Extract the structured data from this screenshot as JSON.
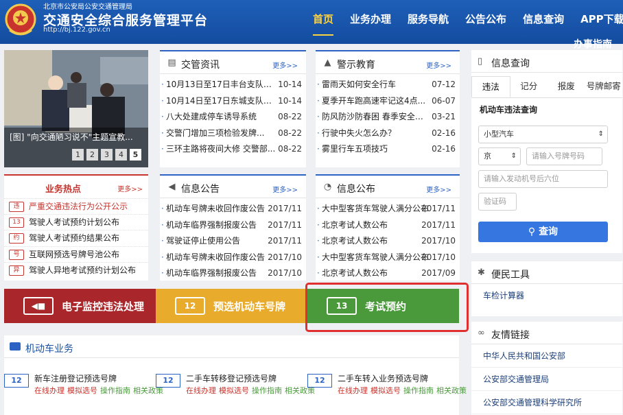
{
  "header": {
    "org": "北京市公安局公安交通管理局",
    "title": "交通安全综合服务管理平台",
    "url": "http://bj.122.gov.cn",
    "nav": [
      "首页",
      "业务办理",
      "服务导航",
      "公告公布",
      "信息查询",
      "APP下载"
    ],
    "nav_overflow": "办事指南"
  },
  "slideshow": {
    "caption": "[图] \"向交通陋习说不\"主题宣教...",
    "pages": [
      "1",
      "2",
      "3",
      "4",
      "5"
    ],
    "active_page": "5"
  },
  "news": {
    "title": "交管资讯",
    "more": "更多>>",
    "items": [
      {
        "text": "10月13日至17日丰台支队方...",
        "date": "10-14"
      },
      {
        "text": "10月14日至17日东城支队广...",
        "date": "10-14"
      },
      {
        "text": "八大处建成停车诱导系统",
        "date": "08-22"
      },
      {
        "text": "交警门增加三项检验发牌...",
        "date": "08-22"
      },
      {
        "text": "三环主路将夜间大修 交警部...",
        "date": "08-22"
      }
    ]
  },
  "warning": {
    "title": "警示教育",
    "more": "更多>>",
    "items": [
      {
        "text": "雷雨天如何安全行车",
        "date": "07-12"
      },
      {
        "text": "夏季开车跑高速牢记这4点...",
        "date": "06-07"
      },
      {
        "text": "防风防沙防春困 春季安全行...",
        "date": "03-21"
      },
      {
        "text": "行驶中失火怎么办？",
        "date": "02-16"
      },
      {
        "text": "雾里行车五项技巧",
        "date": "02-16"
      }
    ]
  },
  "hot": {
    "title": "业务热点",
    "more": "更多>>",
    "items": [
      {
        "icon": "违",
        "text": "严重交通违法行为公开公示"
      },
      {
        "icon": "13",
        "text": "驾驶人考试预约计划公布"
      },
      {
        "icon": "约",
        "text": "驾驶人考试预约结果公布"
      },
      {
        "icon": "号",
        "text": "互联网预选号牌号池公布"
      },
      {
        "icon": "异",
        "text": "驾驶人异地考试预约计划公布"
      }
    ]
  },
  "notice": {
    "title": "信息公告",
    "more": "更多>>",
    "items": [
      {
        "text": "机动车号牌未收回作废公告",
        "date": "2017/11"
      },
      {
        "text": "机动车临界强制报废公告",
        "date": "2017/11"
      },
      {
        "text": "驾驶证停止使用公告",
        "date": "2017/11"
      },
      {
        "text": "机动车号牌未收回作废公告",
        "date": "2017/10"
      },
      {
        "text": "机动车临界强制报废公告",
        "date": "2017/10"
      }
    ]
  },
  "publish": {
    "title": "信息公布",
    "more": "更多>>",
    "items": [
      {
        "text": "大中型客货车驾驶人满分公布",
        "date": "2017/11"
      },
      {
        "text": "北京考试人数公布",
        "date": "2017/11"
      },
      {
        "text": "北京考试人数公布",
        "date": "2017/10"
      },
      {
        "text": "大中型客货车驾驶人满分公布",
        "date": "2017/10"
      },
      {
        "text": "北京考试人数公布",
        "date": "2017/09"
      }
    ]
  },
  "banners": [
    {
      "text": "电子监控违法处理",
      "icon": "◀■",
      "color": "#a9272b"
    },
    {
      "text": "预选机动车号牌",
      "icon": "12",
      "color": "#e8ab2c"
    },
    {
      "text": "考试预约",
      "icon": "13",
      "color": "#4a9a3b"
    }
  ],
  "vehicle": {
    "title": "机动车业务",
    "items": [
      {
        "icon": "12",
        "title": "新车注册登记预选号牌",
        "links": [
          "在线办理",
          "模拟选号",
          "操作指南",
          "相关政策"
        ]
      },
      {
        "icon": "12",
        "title": "二手车转移登记预选号牌",
        "links": [
          "在线办理",
          "模拟选号",
          "操作指南",
          "相关政策"
        ]
      },
      {
        "icon": "12",
        "title": "二手车转入业务预选号牌",
        "links": [
          "在线办理",
          "模拟选号",
          "操作指南",
          "相关政策"
        ]
      }
    ]
  },
  "query": {
    "title": "信息查询",
    "tabs": [
      "违法",
      "记分",
      "报废",
      "号牌邮寄"
    ],
    "form_title": "机动车违法查询",
    "vehicle_type": "小型汽车",
    "province": "京",
    "plate_placeholder": "请输入号牌号码",
    "engine_placeholder": "请输入发动机号后六位",
    "captcha_placeholder": "验证码",
    "button": "查询"
  },
  "tools": {
    "title": "便民工具",
    "items": [
      "车检计算器"
    ]
  },
  "links": {
    "title": "友情链接",
    "items": [
      "中华人民共和国公安部",
      "公安部交通管理局",
      "公安部交通管理科学研究所"
    ]
  },
  "colors": {
    "header": "#1a55aa",
    "accent": "#2b62c4",
    "hot": "#c8342d",
    "highlight": "#e02f2f"
  }
}
